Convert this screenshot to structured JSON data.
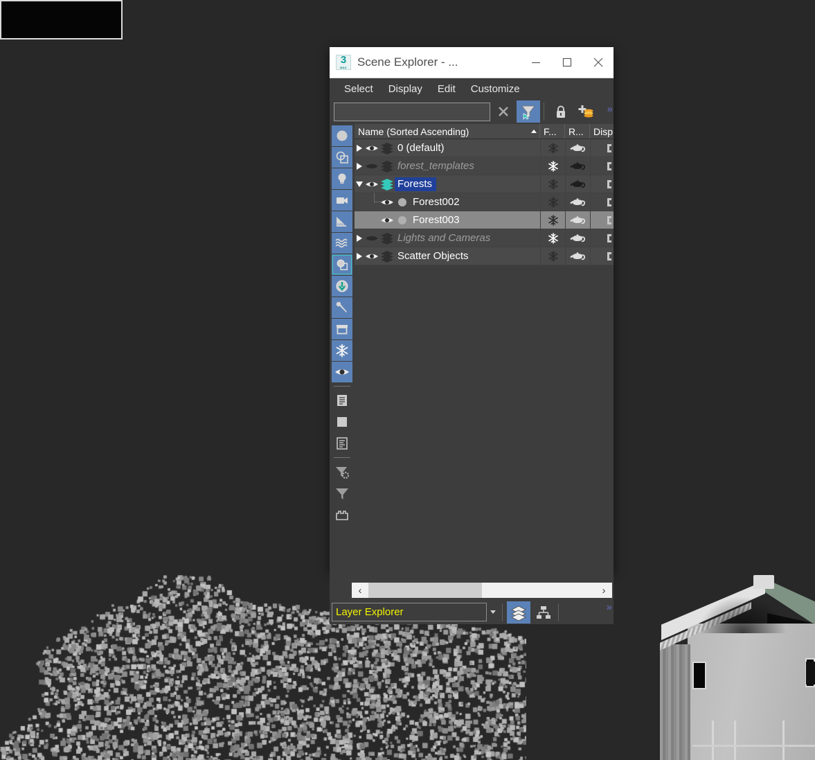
{
  "desktop": {
    "background_color": "#282828"
  },
  "viewport": {
    "label": "3d-viewport",
    "objects": [
      {
        "name": "scattered-forest-proxies",
        "description": "dense field of small gray square proxy objects"
      },
      {
        "name": "house-model",
        "description": "gray house with green-gray gable roof and dark windows"
      }
    ]
  },
  "window": {
    "title": "Scene Explorer - ...",
    "logo_text": "3",
    "logo_sub": "MAX",
    "controls": [
      {
        "name": "minimize-button",
        "glyph": "minimize"
      },
      {
        "name": "maximize-button",
        "glyph": "maximize"
      },
      {
        "name": "close-button",
        "glyph": "close"
      }
    ]
  },
  "menubar": {
    "items": [
      {
        "label": "Select"
      },
      {
        "label": "Display"
      },
      {
        "label": "Edit"
      },
      {
        "label": "Customize"
      }
    ]
  },
  "filterbar": {
    "search": {
      "value": "",
      "placeholder": ""
    },
    "buttons": [
      {
        "name": "clear-search-button",
        "icon": "close-x-icon",
        "active": false
      },
      {
        "name": "selection-filter-button",
        "icon": "filter-cursor-icon",
        "active": true
      },
      {
        "name": "lock-selection-button",
        "icon": "lock-icon",
        "active": false
      },
      {
        "name": "add-layer-button",
        "icon": "plus-layers-icon",
        "active": false
      }
    ],
    "overflow_label": "»"
  },
  "icon_rail": {
    "groups": [
      {
        "buttons": [
          {
            "name": "rail-geometry-toggle",
            "icon": "sphere-icon",
            "active": true
          },
          {
            "name": "rail-shapes-toggle",
            "icon": "shapes-icon",
            "active": true
          },
          {
            "name": "rail-lights-toggle",
            "icon": "lightbulb-icon",
            "active": true
          },
          {
            "name": "rail-cameras-toggle",
            "icon": "camera-icon",
            "active": true
          },
          {
            "name": "rail-helpers-toggle",
            "icon": "ruler-triangle-icon",
            "active": true
          },
          {
            "name": "rail-spacewarps-toggle",
            "icon": "waves-icon",
            "active": true
          },
          {
            "name": "rail-groups-toggle",
            "icon": "group-box-icon",
            "active": true,
            "boxed": true
          },
          {
            "name": "rail-xrefs-toggle",
            "icon": "import-arrow-icon",
            "active": true
          },
          {
            "name": "rail-bones-toggle",
            "icon": "bone-icon",
            "active": true
          },
          {
            "name": "rail-containers-toggle",
            "icon": "container-icon",
            "active": true
          },
          {
            "name": "rail-frozen-toggle",
            "icon": "snowflake-icon",
            "active": true
          },
          {
            "name": "rail-hidden-toggle",
            "icon": "eye-icon",
            "active": true
          }
        ]
      },
      {
        "buttons": [
          {
            "name": "rail-expand-all-button",
            "icon": "document-lines-icon",
            "active": false
          },
          {
            "name": "rail-collapse-all-button",
            "icon": "filled-box-icon",
            "active": false
          },
          {
            "name": "rail-columns-button",
            "icon": "document-outline-icon",
            "active": false
          }
        ]
      },
      {
        "buttons": [
          {
            "name": "rail-configure-filter-button",
            "icon": "filter-gear-icon",
            "active": false
          },
          {
            "name": "rail-filter-button",
            "icon": "filter-icon",
            "active": false
          },
          {
            "name": "rail-container-outline-button",
            "icon": "crate-outline-icon",
            "active": false
          }
        ]
      }
    ]
  },
  "tree": {
    "columns": [
      {
        "name": "column-name",
        "label": "Name (Sorted Ascending)",
        "sort": "ascending"
      },
      {
        "name": "column-frozen",
        "label": "F..."
      },
      {
        "name": "column-render",
        "label": "R..."
      },
      {
        "name": "column-display",
        "label": "Disp"
      }
    ],
    "rows": [
      {
        "label": "0 (default)",
        "depth": 0,
        "twirl": "closed",
        "visible": true,
        "node_type": "layer",
        "layer_color": "dark",
        "style": "normal",
        "selected": false,
        "hovered": false,
        "frozen_icon": "snowflake-icon",
        "frozen_on": false,
        "render_icon": "teapot-icon",
        "render_on": true,
        "display_icon": "display-props-icon"
      },
      {
        "label": "forest_templates",
        "depth": 0,
        "twirl": "closed",
        "visible": false,
        "node_type": "layer",
        "layer_color": "dark",
        "style": "italic-dim",
        "selected": false,
        "hovered": false,
        "frozen_icon": "snowflake-icon",
        "frozen_on": true,
        "render_icon": "teapot-icon",
        "render_on": false,
        "display_icon": "display-props-icon"
      },
      {
        "label": "Forests",
        "depth": 0,
        "twirl": "open",
        "visible": true,
        "node_type": "layer",
        "layer_color": "teal",
        "style": "normal",
        "selected": true,
        "hovered": false,
        "frozen_icon": "snowflake-icon",
        "frozen_on": false,
        "render_icon": "teapot-icon",
        "render_on": false,
        "display_icon": "display-props-icon"
      },
      {
        "label": "Forest002",
        "depth": 1,
        "twirl": "none",
        "visible": true,
        "node_type": "object",
        "style": "normal",
        "selected": false,
        "hovered": false,
        "frozen_icon": "snowflake-icon",
        "frozen_on": false,
        "render_icon": "teapot-icon",
        "render_on": true,
        "display_icon": "display-props-icon"
      },
      {
        "label": "Forest003",
        "depth": 1,
        "twirl": "none",
        "visible": true,
        "node_type": "object",
        "style": "normal",
        "selected": false,
        "hovered": true,
        "frozen_icon": "snowflake-icon",
        "frozen_on": false,
        "render_icon": "teapot-icon",
        "render_on": true,
        "display_icon": "display-props-icon"
      },
      {
        "label": "Lights and Cameras",
        "depth": 0,
        "twirl": "closed",
        "visible": false,
        "node_type": "layer",
        "layer_color": "dark",
        "style": "italic-dim",
        "selected": false,
        "hovered": false,
        "frozen_icon": "snowflake-icon",
        "frozen_on": true,
        "render_icon": "teapot-icon",
        "render_on": true,
        "display_icon": "display-props-icon"
      },
      {
        "label": "Scatter Objects",
        "depth": 0,
        "twirl": "closed",
        "visible": true,
        "node_type": "layer",
        "layer_color": "dark",
        "style": "normal",
        "selected": false,
        "hovered": false,
        "frozen_icon": "snowflake-icon",
        "frozen_on": false,
        "render_icon": "teapot-icon",
        "render_on": true,
        "display_icon": "display-props-icon"
      }
    ]
  },
  "hscrollbar": {
    "left_arrow": "‹",
    "right_arrow": "›"
  },
  "bottombar": {
    "explorer_name": "Layer Explorer",
    "buttons": [
      {
        "name": "layer-mode-button",
        "icon": "layers-icon",
        "active": true
      },
      {
        "name": "hierarchy-mode-button",
        "icon": "hierarchy-icon",
        "active": false
      }
    ],
    "overflow_label": "»"
  },
  "colors": {
    "window_chrome": "#3d3d3d",
    "titlebar": "#ffffff",
    "accent_blue": "#5b82b8",
    "selection_blue": "#20409a",
    "hover_gray": "#8a8a8a",
    "active_layer_teal": "#3ec4b8",
    "explorer_name_yellow": "#f4f400",
    "overflow_purple": "#5a5f9e",
    "roof_green": "#7e9383"
  }
}
